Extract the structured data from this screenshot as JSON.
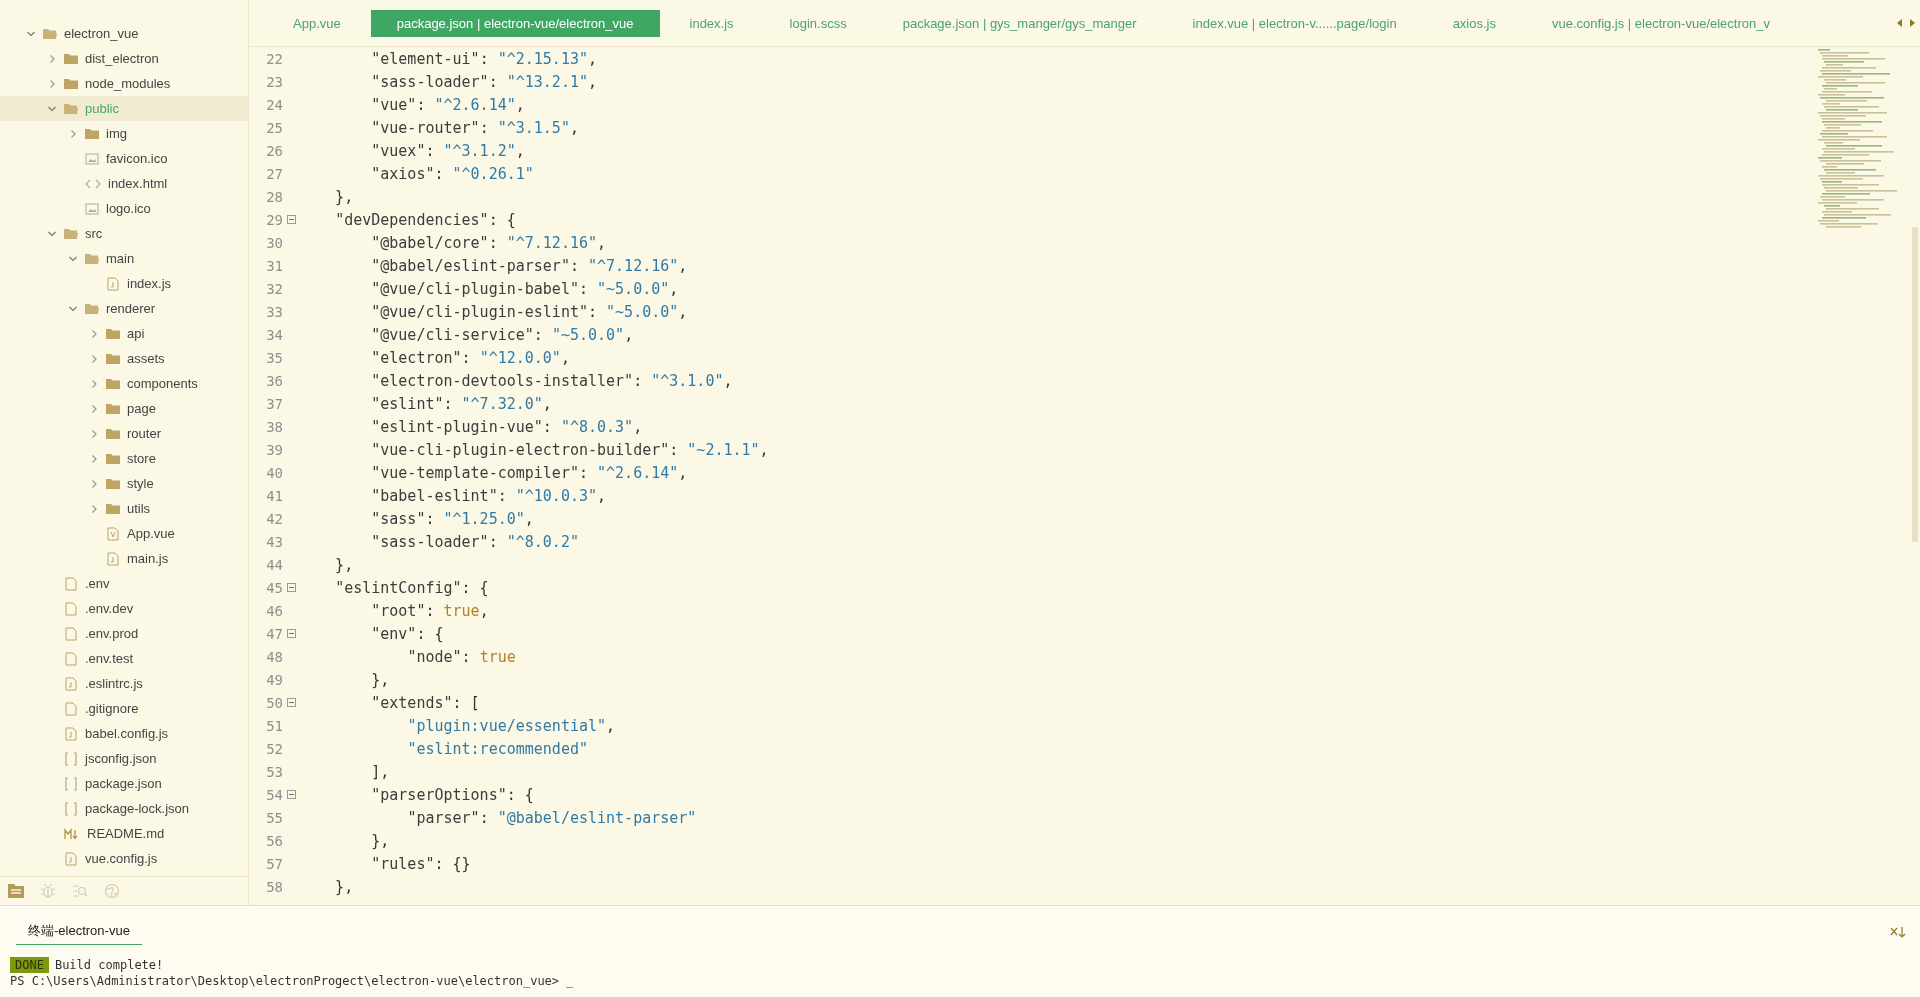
{
  "sidebar": {
    "tree": [
      {
        "name": "electron_vue",
        "kind": "folder",
        "expanded": true,
        "selected": false,
        "children": [
          {
            "name": "dist_electron",
            "kind": "folder",
            "expanded": false,
            "selected": false
          },
          {
            "name": "node_modules",
            "kind": "folder",
            "expanded": false,
            "selected": false
          },
          {
            "name": "public",
            "kind": "folder",
            "expanded": true,
            "selected": true,
            "children": [
              {
                "name": "img",
                "kind": "folder",
                "expanded": false,
                "selected": false
              },
              {
                "name": "favicon.ico",
                "kind": "image",
                "selected": false
              },
              {
                "name": "index.html",
                "kind": "html",
                "selected": false
              },
              {
                "name": "logo.ico",
                "kind": "image",
                "selected": false
              }
            ]
          },
          {
            "name": "src",
            "kind": "folder",
            "expanded": true,
            "selected": false,
            "children": [
              {
                "name": "main",
                "kind": "folder",
                "expanded": true,
                "selected": false,
                "children": [
                  {
                    "name": "index.js",
                    "kind": "js",
                    "selected": false
                  }
                ]
              },
              {
                "name": "renderer",
                "kind": "folder",
                "expanded": true,
                "selected": false,
                "children": [
                  {
                    "name": "api",
                    "kind": "folder",
                    "expanded": false,
                    "selected": false
                  },
                  {
                    "name": "assets",
                    "kind": "folder",
                    "expanded": false,
                    "selected": false
                  },
                  {
                    "name": "components",
                    "kind": "folder",
                    "expanded": false,
                    "selected": false
                  },
                  {
                    "name": "page",
                    "kind": "folder",
                    "expanded": false,
                    "selected": false
                  },
                  {
                    "name": "router",
                    "kind": "folder",
                    "expanded": false,
                    "selected": false
                  },
                  {
                    "name": "store",
                    "kind": "folder",
                    "expanded": false,
                    "selected": false
                  },
                  {
                    "name": "style",
                    "kind": "folder",
                    "expanded": false,
                    "selected": false
                  },
                  {
                    "name": "utils",
                    "kind": "folder",
                    "expanded": false,
                    "selected": false
                  },
                  {
                    "name": "App.vue",
                    "kind": "vue",
                    "selected": false
                  },
                  {
                    "name": "main.js",
                    "kind": "js",
                    "selected": false
                  }
                ]
              }
            ]
          },
          {
            "name": ".env",
            "kind": "plain",
            "selected": false
          },
          {
            "name": ".env.dev",
            "kind": "plain",
            "selected": false
          },
          {
            "name": ".env.prod",
            "kind": "plain",
            "selected": false
          },
          {
            "name": ".env.test",
            "kind": "plain",
            "selected": false
          },
          {
            "name": ".eslintrc.js",
            "kind": "js",
            "selected": false
          },
          {
            "name": ".gitignore",
            "kind": "plain",
            "selected": false
          },
          {
            "name": "babel.config.js",
            "kind": "js",
            "selected": false
          },
          {
            "name": "jsconfig.json",
            "kind": "json",
            "selected": false
          },
          {
            "name": "package.json",
            "kind": "json",
            "selected": false
          },
          {
            "name": "package-lock.json",
            "kind": "json",
            "selected": false
          },
          {
            "name": "README.md",
            "kind": "md",
            "selected": false
          },
          {
            "name": "vue.config.js",
            "kind": "js",
            "selected": false
          }
        ]
      }
    ],
    "bottom_icons": [
      {
        "kind": "files",
        "selected": true
      },
      {
        "kind": "bug",
        "selected": false
      },
      {
        "kind": "search",
        "selected": false
      },
      {
        "kind": "globe",
        "selected": false
      }
    ]
  },
  "tabs": [
    {
      "label": "App.vue",
      "selected": false
    },
    {
      "label": "package.json | electron-vue/electron_vue",
      "selected": true
    },
    {
      "label": "index.js",
      "selected": false
    },
    {
      "label": "login.scss",
      "selected": false
    },
    {
      "label": "package.json | gys_manger/gys_manger",
      "selected": false
    },
    {
      "label": "index.vue | electron-v......page/login",
      "selected": false
    },
    {
      "label": "axios.js",
      "selected": false
    },
    {
      "label": "vue.config.js | electron-vue/electron_v",
      "selected": false
    }
  ],
  "editor": {
    "lines": [
      {
        "number": "22",
        "text": "        \"element-ui\": \"^2.15.13\",",
        "fold": false
      },
      {
        "number": "23",
        "text": "        \"sass-loader\": \"^13.2.1\",",
        "fold": false
      },
      {
        "number": "24",
        "text": "        \"vue\": \"^2.6.14\",",
        "fold": false
      },
      {
        "number": "25",
        "text": "        \"vue-router\": \"^3.1.5\",",
        "fold": false
      },
      {
        "number": "26",
        "text": "        \"vuex\": \"^3.1.2\",",
        "fold": false
      },
      {
        "number": "27",
        "text": "        \"axios\": \"^0.26.1\"",
        "fold": false
      },
      {
        "number": "28",
        "text": "    },",
        "fold": false
      },
      {
        "number": "29",
        "text": "    \"devDependencies\": {",
        "fold": true
      },
      {
        "number": "30",
        "text": "        \"@babel/core\": \"^7.12.16\",",
        "fold": false
      },
      {
        "number": "31",
        "text": "        \"@babel/eslint-parser\": \"^7.12.16\",",
        "fold": false
      },
      {
        "number": "32",
        "text": "        \"@vue/cli-plugin-babel\": \"~5.0.0\",",
        "fold": false
      },
      {
        "number": "33",
        "text": "        \"@vue/cli-plugin-eslint\": \"~5.0.0\",",
        "fold": false
      },
      {
        "number": "34",
        "text": "        \"@vue/cli-service\": \"~5.0.0\",",
        "fold": false
      },
      {
        "number": "35",
        "text": "        \"electron\": \"^12.0.0\",",
        "fold": false
      },
      {
        "number": "36",
        "text": "        \"electron-devtools-installer\": \"^3.1.0\",",
        "fold": false
      },
      {
        "number": "37",
        "text": "        \"eslint\": \"^7.32.0\",",
        "fold": false
      },
      {
        "number": "38",
        "text": "        \"eslint-plugin-vue\": \"^8.0.3\",",
        "fold": false
      },
      {
        "number": "39",
        "text": "        \"vue-cli-plugin-electron-builder\": \"~2.1.1\",",
        "fold": false
      },
      {
        "number": "40",
        "text": "        \"vue-template-compiler\": \"^2.6.14\",",
        "fold": false
      },
      {
        "number": "41",
        "text": "        \"babel-eslint\": \"^10.0.3\",",
        "fold": false
      },
      {
        "number": "42",
        "text": "        \"sass\": \"^1.25.0\",",
        "fold": false
      },
      {
        "number": "43",
        "text": "        \"sass-loader\": \"^8.0.2\"",
        "fold": false
      },
      {
        "number": "44",
        "text": "    },",
        "fold": false
      },
      {
        "number": "45",
        "text": "    \"eslintConfig\": {",
        "fold": true
      },
      {
        "number": "46",
        "text": "        \"root\": true,",
        "fold": false
      },
      {
        "number": "47",
        "text": "        \"env\": {",
        "fold": true
      },
      {
        "number": "48",
        "text": "            \"node\": true",
        "fold": false
      },
      {
        "number": "49",
        "text": "        },",
        "fold": false
      },
      {
        "number": "50",
        "text": "        \"extends\": [",
        "fold": true
      },
      {
        "number": "51",
        "text": "            \"plugin:vue/essential\",",
        "fold": false
      },
      {
        "number": "52",
        "text": "            \"eslint:recommended\"",
        "fold": false
      },
      {
        "number": "53",
        "text": "        ],",
        "fold": false
      },
      {
        "number": "54",
        "text": "        \"parserOptions\": {",
        "fold": true
      },
      {
        "number": "55",
        "text": "            \"parser\": \"@babel/eslint-parser\"",
        "fold": false
      },
      {
        "number": "56",
        "text": "        },",
        "fold": false
      },
      {
        "number": "57",
        "text": "        \"rules\": {}",
        "fold": false
      },
      {
        "number": "58",
        "text": "    },",
        "fold": false
      }
    ]
  },
  "terminal": {
    "tab": {
      "label": "终端-electron-vue",
      "selected": true
    },
    "badge": "DONE",
    "message": "Build complete!",
    "prompt": "PS C:\\Users\\Administrator\\Desktop\\electronProgect\\electron-vue\\electron_vue>",
    "cursor": "_"
  }
}
